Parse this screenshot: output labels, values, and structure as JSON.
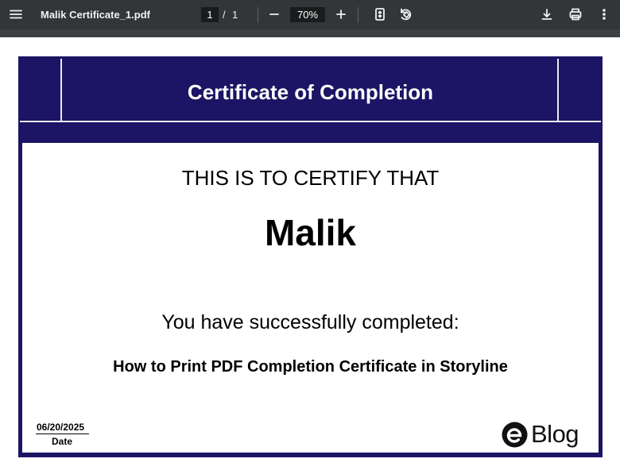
{
  "viewer": {
    "file_title": "Malik Certificate_1.pdf",
    "current_page": "1",
    "page_separator": "/",
    "total_pages": "1",
    "zoom": "70%"
  },
  "certificate": {
    "title": "Certificate of Completion",
    "certify_line": "THIS IS TO CERTIFY THAT",
    "recipient_name": "Malik",
    "completed_line": "You have successfully completed:",
    "course_name": "How to Print PDF Completion Certificate in Storyline",
    "date_value": "06/20/2025",
    "date_label": "Date",
    "logo_text": "Blog",
    "colors": {
      "band": "#1c1464",
      "toolbar": "#323639"
    }
  },
  "icons": [
    "menu-icon",
    "zoom-out-icon",
    "zoom-in-icon",
    "fit-page-icon",
    "rotate-icon",
    "download-icon",
    "print-icon",
    "more-vert-icon"
  ]
}
